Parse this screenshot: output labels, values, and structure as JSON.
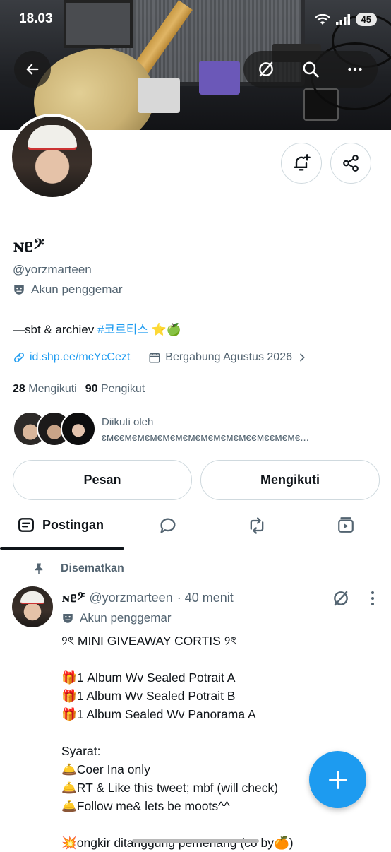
{
  "status_bar": {
    "time": "18.03",
    "battery": "45"
  },
  "profile": {
    "display_name": "ɴᥱ𝄢",
    "handle": "@yorzmarteen",
    "account_label": "Akun penggemar",
    "bio_text": "—sbt & archiev ",
    "bio_hashtag": "#코르티스",
    "bio_emoji": "⭐🍏",
    "link": "id.shp.ee/mcYcCezt",
    "joined": "Bergabung Agustus 2026",
    "following_count": "28",
    "following_label": "Mengikuti",
    "followers_count": "90",
    "followers_label": "Pengikut",
    "followed_by_title": "Diikuti oleh",
    "followed_by_names": "ɛмєємємємємємємємємємємєємєємємє..."
  },
  "actions": {
    "message": "Pesan",
    "following": "Mengikuti"
  },
  "tabs": {
    "posts": "Postingan"
  },
  "post": {
    "pinned_label": "Disematkan",
    "name": "ɴᥱ𝄢",
    "handle": "@yorzmarteen",
    "time": "· 40 menit",
    "account_label": "Akun penggemar",
    "body": "୨ৎ MINI GIVEAWAY CORTIS ୨ৎ\n\n🎁1 Album Wv Sealed Potrait A\n🎁1 Album Wv Sealed Potrait B\n🎁1 Album Sealed Wv Panorama A\n\nSyarat:\n🛎️Coer Ina only\n🛎️RT & Like this tweet; mbf (will check)\n🛎️Follow me& lets be moots^^\n\n💥ongkir ditanggung pemenang (co by🍊)"
  },
  "colors": {
    "accent": "#1d9bf0",
    "secondary_text": "#536471",
    "primary_text": "#0f1419"
  },
  "icons": [
    "back-arrow-icon",
    "grok-icon",
    "search-icon",
    "more-icon",
    "notification-bell-icon",
    "share-icon",
    "masks-icon",
    "link-icon",
    "calendar-icon",
    "chevron-right-icon",
    "posts-icon",
    "replies-icon",
    "reposts-icon",
    "media-icon",
    "pin-icon",
    "compose-plus-icon"
  ]
}
